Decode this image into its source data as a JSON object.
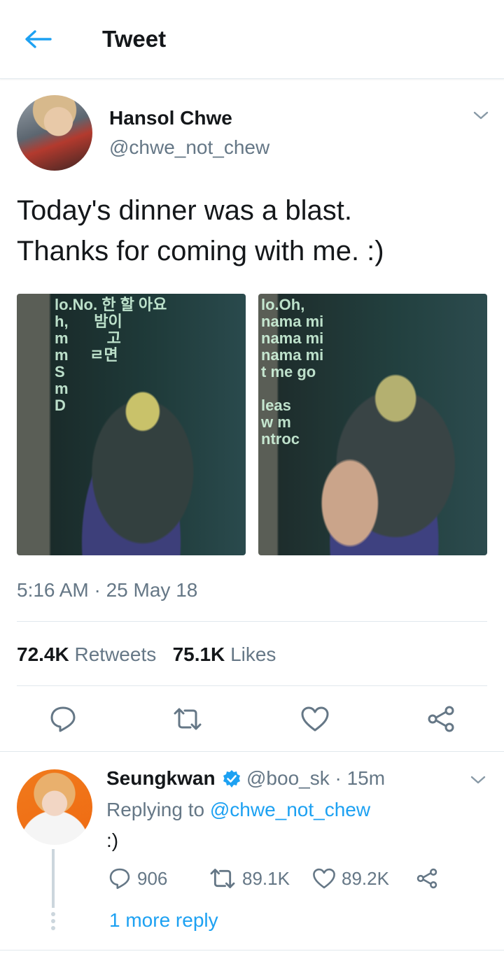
{
  "header": {
    "title": "Tweet",
    "back_icon": "arrow-left-icon",
    "accent": "#1da1f2"
  },
  "tweet": {
    "author_name": "Hansol Chwe",
    "author_handle": "@chwe_not_chew",
    "text_line1": "Today's dinner was a blast.",
    "text_line2": "Thanks for coming with me. :)",
    "photo1_text": "lo.No. 한 할 아요\nh,      밤이\nm         고\nm     ㄹ면\nS\nm\nD",
    "photo2_text": "lo.Oh,\nnama mi\nnama mi\nnama mi\nt me go\n\nleas\nw m\nntroc",
    "timestamp": "5:16 AM · 25 May 18",
    "retweet_count": "72.4K",
    "retweet_label": "Retweets",
    "like_count": "75.1K",
    "like_label": "Likes"
  },
  "reply": {
    "author_name": "Seungkwan",
    "author_handle": "@boo_sk",
    "time": "· 15m",
    "replying_prefix": "Replying to",
    "replying_handle": "@chwe_not_chew",
    "text": ":)",
    "reply_count": "906",
    "retweet_count": "89.1K",
    "like_count": "89.2K",
    "more_replies": "1 more reply"
  },
  "colors": {
    "text": "#14171a",
    "secondary": "#657786",
    "divider": "#e1e8ed",
    "link": "#1da1f2"
  }
}
